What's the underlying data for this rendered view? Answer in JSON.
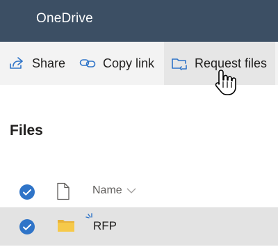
{
  "app": {
    "title": "OneDrive"
  },
  "commands": {
    "share_label": "Share",
    "copy_link_label": "Copy link",
    "request_files_label": "Request files"
  },
  "section": {
    "heading": "Files"
  },
  "list": {
    "columns": {
      "name": "Name"
    },
    "rows": [
      {
        "name": "RFP",
        "type": "folder",
        "selected": true
      }
    ]
  },
  "icons": {
    "share": "share-icon",
    "copy_link": "link-icon",
    "request_files": "folder-request-icon",
    "cursor": "hand-pointer-icon"
  },
  "colors": {
    "topbar": "#3c4f64",
    "accent": "#2f74c8",
    "folder": "#f6c94a"
  }
}
